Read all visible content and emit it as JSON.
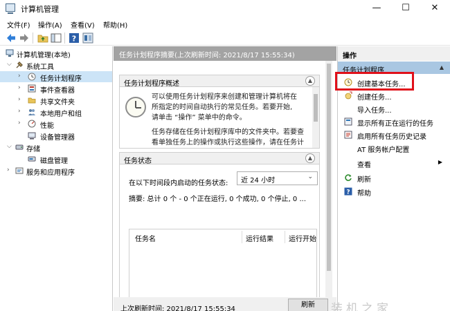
{
  "window": {
    "title": "计算机管理",
    "controls": {
      "minimize": "—",
      "maximize": "☐",
      "close": "✕"
    }
  },
  "menu": [
    "文件(F)",
    "操作(A)",
    "查看(V)",
    "帮助(H)"
  ],
  "toolbar": {
    "icons": [
      "back-arrow-icon",
      "forward-arrow-icon",
      "folder-up-icon",
      "show-hide-tree-icon",
      "help-icon",
      "properties-icon"
    ]
  },
  "tree": [
    {
      "label": "计算机管理(本地)",
      "icon": "computer-icon"
    },
    {
      "label": "系统工具",
      "icon": "tools-icon"
    },
    {
      "label": "任务计划程序",
      "icon": "clock-icon"
    },
    {
      "label": "事件查看器",
      "icon": "event-viewer-icon"
    },
    {
      "label": "共享文件夹",
      "icon": "shared-folder-icon"
    },
    {
      "label": "本地用户和组",
      "icon": "users-icon"
    },
    {
      "label": "性能",
      "icon": "performance-icon"
    },
    {
      "label": "设备管理器",
      "icon": "device-manager-icon"
    },
    {
      "label": "存储",
      "icon": "storage-icon"
    },
    {
      "label": "磁盘管理",
      "icon": "disk-icon"
    },
    {
      "label": "服务和应用程序",
      "icon": "services-icon"
    }
  ],
  "center": {
    "header": "任务计划程序摘要(上次刷新时间: 2021/8/17 15:55:34)",
    "overview": {
      "title": "任务计划程序概述",
      "lines": [
        "可以使用任务计划程序来创建和管理计算机将在",
        "所指定的时间自动执行的常见任务。若要开始,",
        "请单击 “操作” 菜单中的命令。",
        "",
        "任务存储在任务计划程序库中的文件夹中。若要查",
        "看单独任务上的操作或执行这些操作，请在任务计"
      ]
    },
    "status": {
      "title": "任务状态",
      "label": "在以下时间段内启动的任务状态:",
      "dropdown_value": "近 24 小时",
      "summary": "摘要: 总计 0 个 - 0 个正在运行, 0 个成功, 0 个停止, 0 ...",
      "columns": [
        "任务名",
        "运行结果",
        "运行开始"
      ]
    },
    "last_refresh": "上次刷新时间: 2021/8/17 15:55:34",
    "refresh_button": "刷新"
  },
  "actions": {
    "title": "操作",
    "group": "任务计划程序",
    "items": [
      {
        "label": "创建基本任务...",
        "icon": "create-basic-task-icon"
      },
      {
        "label": "创建任务...",
        "icon": "create-task-icon"
      },
      {
        "label": "导入任务...",
        "icon": ""
      },
      {
        "label": "显示所有正在运行的任务",
        "icon": "running-tasks-icon"
      },
      {
        "label": "启用所有任务历史记录",
        "icon": "task-history-icon"
      },
      {
        "label": "AT 服务帐户配置",
        "icon": ""
      },
      {
        "label": "查看",
        "icon": ""
      },
      {
        "label": "刷新",
        "icon": "refresh-icon"
      },
      {
        "label": "帮助",
        "icon": "help-icon"
      }
    ]
  },
  "watermark": "装机之家",
  "colors": {
    "highlight": "#e0101a",
    "group_bg": "#a9c7e2",
    "selected_bg": "#cce4f7",
    "header_bg": "#a3a3a3"
  }
}
